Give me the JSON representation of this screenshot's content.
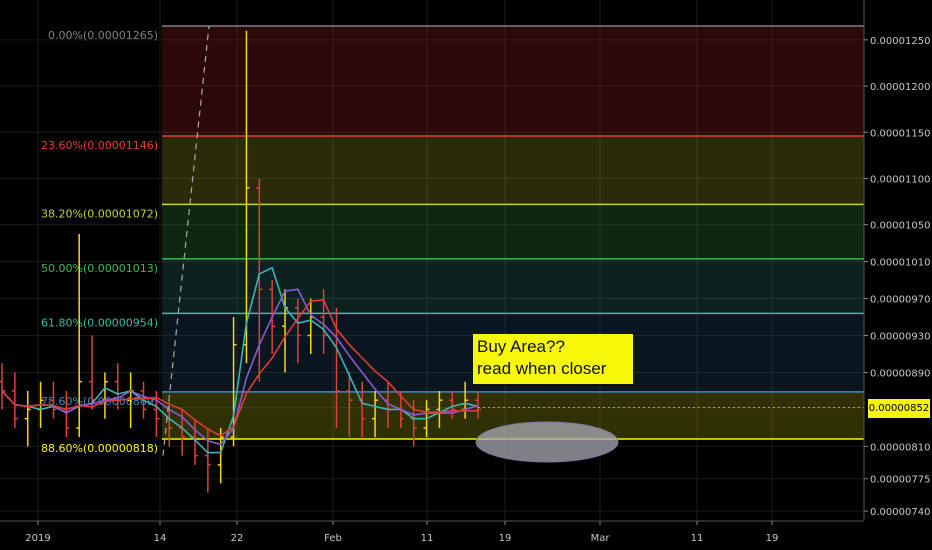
{
  "chart_data": {
    "type": "candlestick",
    "price_axis": {
      "ticks": [
        "0.00001250",
        "0.00001200",
        "0.00001150",
        "0.00001100",
        "0.00001050",
        "0.00001010",
        "0.00000970",
        "0.00000930",
        "0.00000890",
        "0.00000852",
        "0.00000810",
        "0.00000775",
        "0.00000740"
      ],
      "tick_values": [
        1.25e-05,
        1.2e-05,
        1.15e-05,
        1.1e-05,
        1.05e-05,
        1.01e-05,
        9.7e-06,
        9.3e-06,
        8.9e-06,
        8.52e-06,
        8.1e-06,
        7.75e-06,
        7.4e-06
      ],
      "current_price": "0.00000852"
    },
    "time_axis": {
      "labels": [
        "2019",
        "14",
        "22",
        "Feb",
        "11",
        "19",
        "Mar",
        "11",
        "19"
      ]
    },
    "fib_levels": [
      {
        "label": "0.00%(0.00001265)",
        "value": 1.265e-05,
        "color": "#808080"
      },
      {
        "label": "23.60%(0.00001146)",
        "value": 1.146e-05,
        "color": "#e0403a"
      },
      {
        "label": "38.20%(0.00001072)",
        "value": 1.072e-05,
        "color": "#c8d23c"
      },
      {
        "label": "50.00%(0.00001013)",
        "value": 1.013e-05,
        "color": "#3cbc50"
      },
      {
        "label": "61.80%(0.00000954)",
        "value": 9.54e-06,
        "color": "#3cbcaa"
      },
      {
        "label": "78.60%(0.00000869)",
        "value": 8.69e-06,
        "color": "#3c8cbc"
      },
      {
        "label": "88.60%(0.00000818)",
        "value": 8.18e-06,
        "color": "#f5f50a"
      }
    ],
    "candles": [
      [
        8.8e-06,
        9e-06,
        8.5e-06,
        8.7e-06
      ],
      [
        8.7e-06,
        8.9e-06,
        8.3e-06,
        8.4e-06
      ],
      [
        8.4e-06,
        8.7e-06,
        8.1e-06,
        8.5e-06
      ],
      [
        8.5e-06,
        8.8e-06,
        8.3e-06,
        8.6e-06
      ],
      [
        8.6e-06,
        8.8e-06,
        8.4e-06,
        8.5e-06
      ],
      [
        8.5e-06,
        8.7e-06,
        8.2e-06,
        8.3e-06
      ],
      [
        8.3e-06,
        1.04e-05,
        8.2e-06,
        8.8e-06
      ],
      [
        8.8e-06,
        9.3e-06,
        8.5e-06,
        8.6e-06
      ],
      [
        8.6e-06,
        8.9e-06,
        8.4e-06,
        8.8e-06
      ],
      [
        8.8e-06,
        9e-06,
        8.5e-06,
        8.6e-06
      ],
      [
        8.6e-06,
        8.9e-06,
        8.3e-06,
        8.7e-06
      ],
      [
        8.7e-06,
        8.8e-06,
        8.4e-06,
        8.5e-06
      ],
      [
        8.5e-06,
        8.7e-06,
        8.2e-06,
        8.4e-06
      ],
      [
        8.4e-06,
        8.6e-06,
        8.1e-06,
        8.3e-06
      ],
      [
        8.3e-06,
        8.5e-06,
        8e-06,
        8.2e-06
      ],
      [
        8.2e-06,
        8.4e-06,
        7.9e-06,
        8e-06
      ],
      [
        8e-06,
        8.3e-06,
        7.6e-06,
        7.9e-06
      ],
      [
        7.9e-06,
        8.3e-06,
        7.7e-06,
        8.2e-06
      ],
      [
        8.2e-06,
        9.5e-06,
        8.1e-06,
        9.2e-06
      ],
      [
        9.2e-06,
        1.26e-05,
        9e-06,
        1.09e-05
      ],
      [
        1.09e-05,
        1.1e-05,
        8.8e-06,
        9.8e-06
      ],
      [
        9.8e-06,
        9.9e-06,
        9.1e-06,
        9.4e-06
      ],
      [
        9.4e-06,
        9.8e-06,
        8.9e-06,
        9.6e-06
      ],
      [
        9.6e-06,
        9.7e-06,
        9e-06,
        9.3e-06
      ],
      [
        9.3e-06,
        9.7e-06,
        9.1e-06,
        9.5e-06
      ],
      [
        9.5e-06,
        9.8e-06,
        9.1e-06,
        9.3e-06
      ],
      [
        9.3e-06,
        9.6e-06,
        8.3e-06,
        8.7e-06
      ],
      [
        8.7e-06,
        8.9e-06,
        8.2e-06,
        8.6e-06
      ],
      [
        8.6e-06,
        8.8e-06,
        8.2e-06,
        8.4e-06
      ],
      [
        8.4e-06,
        8.7e-06,
        8.2e-06,
        8.6e-06
      ],
      [
        8.6e-06,
        8.8e-06,
        8.3e-06,
        8.5e-06
      ],
      [
        8.5e-06,
        8.7e-06,
        8.3e-06,
        8.4e-06
      ],
      [
        8.4e-06,
        8.6e-06,
        8.1e-06,
        8.3e-06
      ],
      [
        8.3e-06,
        8.6e-06,
        8.2e-06,
        8.5e-06
      ],
      [
        8.5e-06,
        8.7e-06,
        8.3e-06,
        8.6e-06
      ],
      [
        8.6e-06,
        8.7e-06,
        8.4e-06,
        8.5e-06
      ],
      [
        8.5e-06,
        8.8e-06,
        8.4e-06,
        8.6e-06
      ],
      [
        8.6e-06,
        8.7e-06,
        8.4e-06,
        8.5e-06
      ]
    ],
    "grid": true
  },
  "annotation": {
    "line1": "Buy Area??",
    "line2": "read when closer"
  }
}
